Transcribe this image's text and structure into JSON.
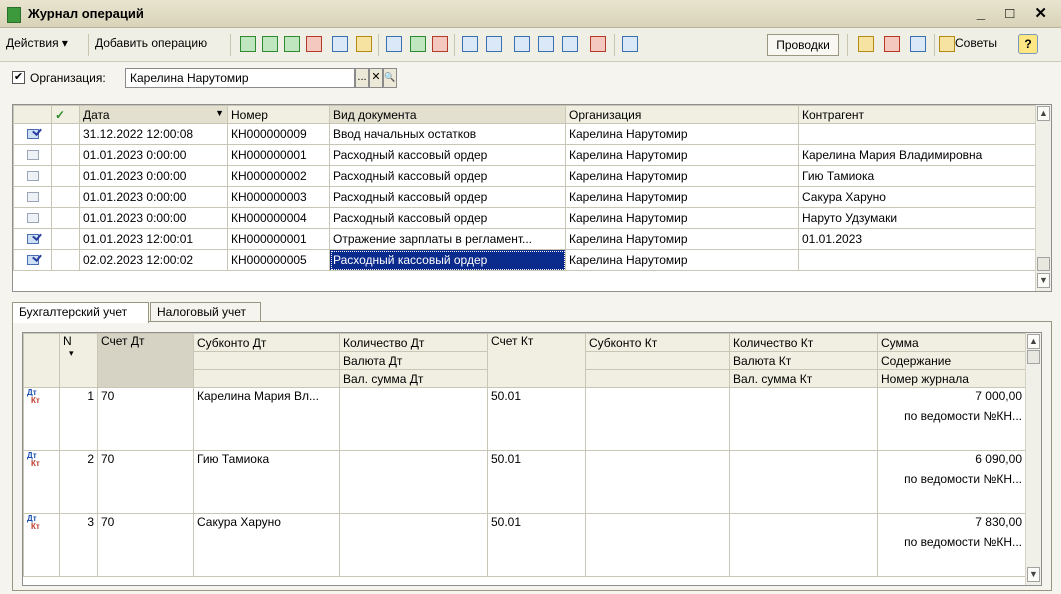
{
  "window": {
    "title": "Журнал операций",
    "controls": "_ □ ✕"
  },
  "toolbar": {
    "actions": "Действия ▾",
    "add_operation": "Добавить операцию",
    "provodki": "Проводки",
    "sovety": "Советы",
    "help": "?"
  },
  "filter": {
    "checked": "✔",
    "label": "Организация:",
    "value": "Карелина Нарутомир",
    "btn_select": "...",
    "btn_clear": "✕",
    "btn_search": "🔍"
  },
  "journal": {
    "columns": {
      "date": "Дата",
      "number": "Номер",
      "doctype": "Вид документа",
      "org": "Организация",
      "counterparty": "Контрагент"
    },
    "rows": [
      {
        "icon": "posted-document-icon",
        "date": "31.12.2022 12:00:08",
        "number": "КН000000009",
        "doctype": "Ввод начальных остатков",
        "org": "Карелина Нарутомир",
        "counterparty": ""
      },
      {
        "icon": "document-icon",
        "date": "01.01.2023 0:00:00",
        "number": "КН000000001",
        "doctype": "Расходный кассовый ордер",
        "org": "Карелина Нарутомир",
        "counterparty": "Карелина Мария Владимировна"
      },
      {
        "icon": "document-icon",
        "date": "01.01.2023 0:00:00",
        "number": "КН000000002",
        "doctype": "Расходный кассовый ордер",
        "org": "Карелина Нарутомир",
        "counterparty": "Гию Тамиока"
      },
      {
        "icon": "document-icon",
        "date": "01.01.2023 0:00:00",
        "number": "КН000000003",
        "doctype": "Расходный кассовый ордер",
        "org": "Карелина Нарутомир",
        "counterparty": "Сакура Харуно"
      },
      {
        "icon": "document-icon",
        "date": "01.01.2023 0:00:00",
        "number": "КН000000004",
        "doctype": "Расходный кассовый ордер",
        "org": "Карелина Нарутомир",
        "counterparty": "Наруто Удзумаки"
      },
      {
        "icon": "posted-document-icon",
        "date": "01.01.2023 12:00:01",
        "number": "КН000000001",
        "doctype": "Отражение зарплаты в регламент...",
        "org": "Карелина Нарутомир",
        "counterparty": "01.01.2023"
      },
      {
        "icon": "posted-document-icon",
        "date": "02.02.2023 12:00:02",
        "number": "КН000000005",
        "doctype": "Расходный кассовый ордер",
        "org": "Карелина Нарутомир",
        "counterparty": ""
      }
    ]
  },
  "tabs": {
    "accounting": "Бухгалтерский учет",
    "tax": "Налоговый учет"
  },
  "entries": {
    "columns": {
      "n": "N",
      "sort": "▾",
      "acc_dt": "Счет Дт",
      "subconto_dt": "Субконто Дт",
      "qty_dt": "Количество Дт",
      "cur_dt": "Валюта Дт",
      "cursum_dt": "Вал. сумма Дт",
      "acc_kt": "Счет Кт",
      "subconto_kt": "Субконто Кт",
      "qty_kt": "Количество Кт",
      "cur_kt": "Валюта Кт",
      "cursum_kt": "Вал. сумма Кт",
      "sum": "Сумма",
      "content": "Содержание",
      "journal_no": "Номер журнала"
    },
    "icon_dt": "Дт",
    "icon_kt": "Кт",
    "rows": [
      {
        "n": "1",
        "acc_dt": "70",
        "subconto_dt": "Карелина Мария Вл...",
        "acc_kt": "50.01",
        "sum": "7 000,00",
        "content": "по ведомости №КН..."
      },
      {
        "n": "2",
        "acc_dt": "70",
        "subconto_dt": "Гию Тамиока",
        "acc_kt": "50.01",
        "sum": "6 090,00",
        "content": "по ведомости №КН..."
      },
      {
        "n": "3",
        "acc_dt": "70",
        "subconto_dt": "Сакура Харуно",
        "acc_kt": "50.01",
        "sum": "7 830,00",
        "content": "по ведомости №КН..."
      }
    ]
  }
}
